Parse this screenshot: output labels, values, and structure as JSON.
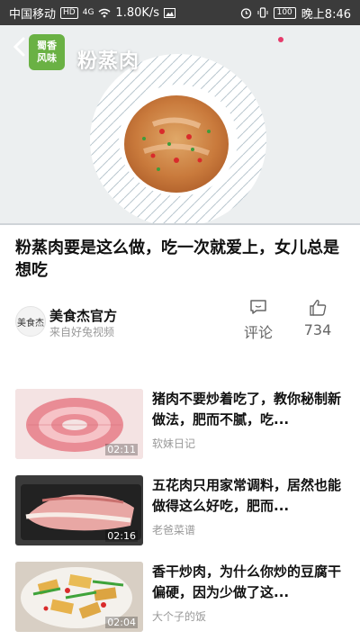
{
  "status_bar": {
    "carrier": "中国移动",
    "hd": "HD",
    "signal": "4G",
    "speed": "1.80K/s",
    "battery": "100",
    "time": "晚上8:46"
  },
  "hero": {
    "channel_badge_line1": "蜀香",
    "channel_badge_line2": "风味",
    "overlay_title": "粉蒸肉"
  },
  "video": {
    "title": "粉蒸肉要是这么做，吃一次就爱上，女儿总是想吃"
  },
  "author": {
    "avatar_text": "美食杰",
    "name": "美食杰官方",
    "source": "来自好兔视频"
  },
  "actions": {
    "comment_label": "评论",
    "like_count": "734"
  },
  "recommended": [
    {
      "title": "猪肉不要炒着吃了，教你秘制新做法，肥而不腻，吃...",
      "source": "软妹日记",
      "duration": "02:11"
    },
    {
      "title": "五花肉只用家常调料，居然也能做得这么好吃，肥而...",
      "source": "老爸菜谱",
      "duration": "02:16"
    },
    {
      "title": "香干炒肉，为什么你炒的豆腐干偏硬，因为少做了这...",
      "source": "大个子的饭",
      "duration": "02:04"
    }
  ],
  "colors": {
    "status_bar_bg": "#3b3b3b",
    "badge_green": "#6ab144",
    "secondary_text": "#999999"
  }
}
